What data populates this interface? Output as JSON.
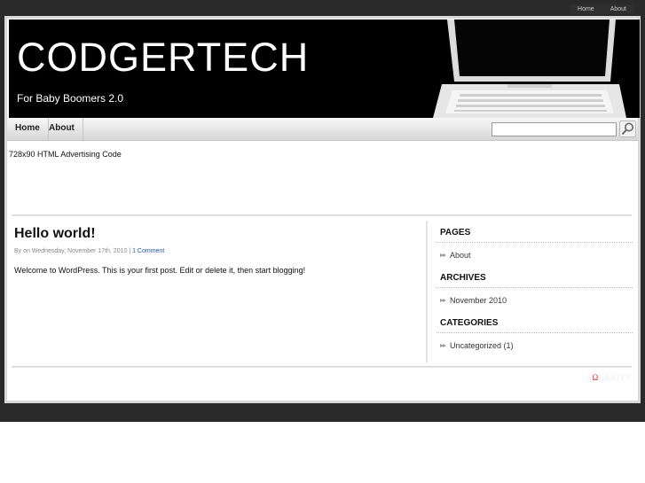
{
  "top_links": [
    "Home",
    "About"
  ],
  "header": {
    "title": "CODGERTECH",
    "tagline": "For Baby Boomers 2.0"
  },
  "nav": {
    "items": [
      "Home",
      "About"
    ],
    "search": {
      "value": "",
      "placeholder": ""
    }
  },
  "ad_text": "728x90 HTML Advertising Code",
  "post": {
    "title": "Hello world!",
    "meta_prefix": "By on Wednesday, November 17th, 2010 | ",
    "meta_link": "1 Comment",
    "body": "Welcome to WordPress. This is your first post. Edit or delete it, then start blogging!"
  },
  "sidebar": {
    "pages_title": "PAGES",
    "pages": [
      "About"
    ],
    "archives_title": "ARCHIVES",
    "archives": [
      "November 2010"
    ],
    "categories_title": "CATEGORIES",
    "categories": [
      "Uncategorized (1)"
    ]
  },
  "footer": {
    "logo_left": "S",
    "logo_o": "Ω",
    "logo_right": "CRATES"
  },
  "colors": {
    "header_bg": "#000000",
    "page_bg": "#2a2a2a",
    "link": "#2255aa"
  },
  "icons": {
    "search_button": "magnifier-icon",
    "list_bullet": "arrow-bullet-icon",
    "laptop": "laptop-image"
  }
}
